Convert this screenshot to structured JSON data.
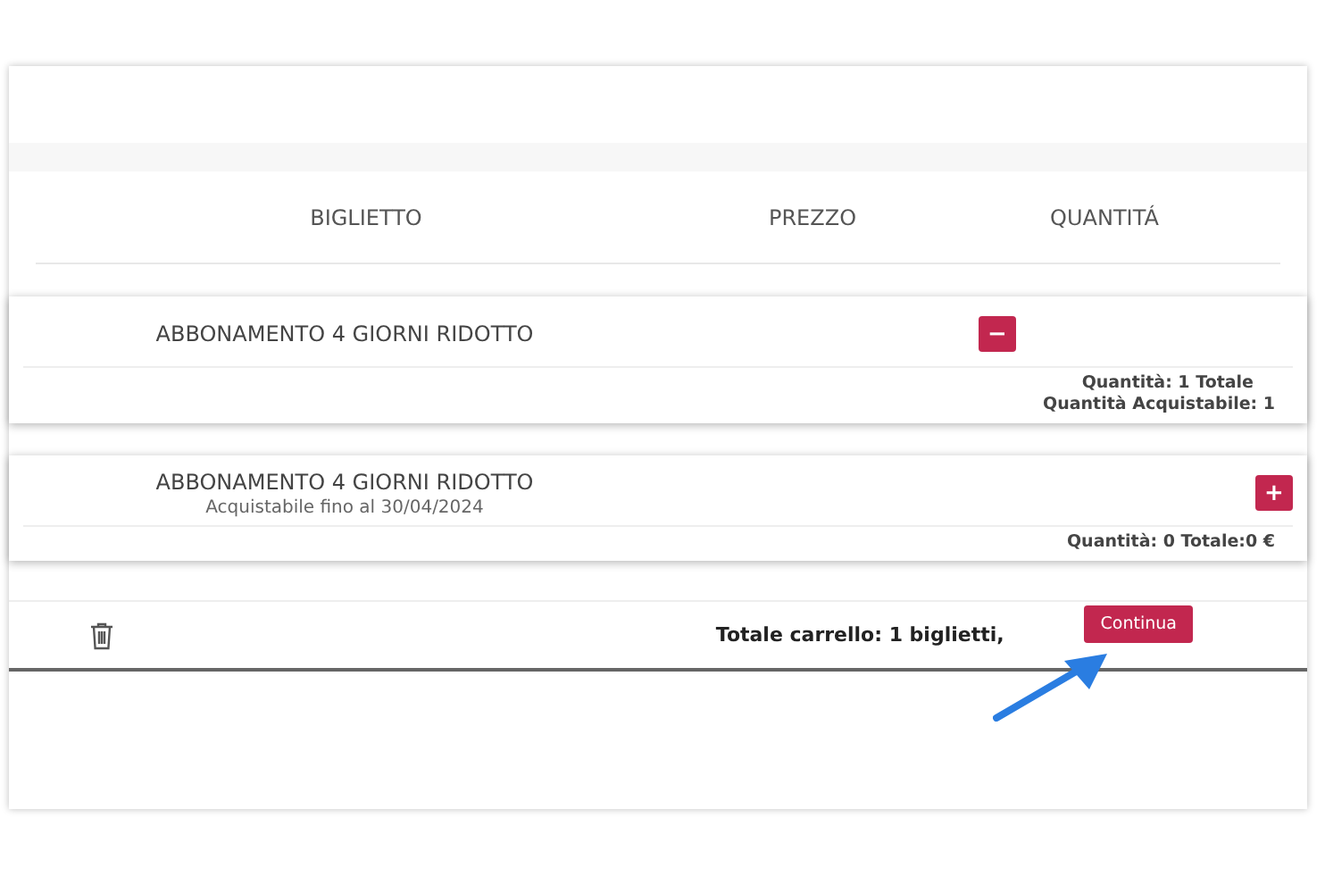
{
  "table": {
    "columns": [
      "BIGLIETTO",
      "PREZZO",
      "QUANTITÁ"
    ]
  },
  "tickets": [
    {
      "name": "ABBONAMENTO 4 GIORNI RIDOTTO",
      "action": {
        "kind": "remove",
        "symbol": "−"
      },
      "summary": [
        "Quantità: 1 Totale",
        "Quantità Acquistabile: 1"
      ]
    },
    {
      "name": "ABBONAMENTO 4 GIORNI RIDOTTO",
      "note": "Acquistabile fino al 30/04/2024",
      "action": {
        "kind": "add",
        "symbol": "+"
      },
      "summary": [
        "Quantità: 0 Totale:0 €"
      ]
    }
  ],
  "footer": {
    "total": "Totale carrello: 1 biglietti,",
    "button": "Continua"
  }
}
